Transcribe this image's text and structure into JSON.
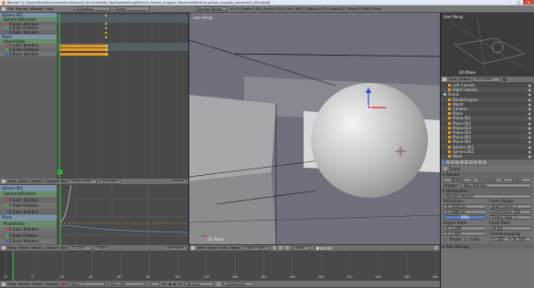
{
  "window": {
    "title": "Blender* [C:\\Users\\Tom\\Documents\\Architecture\\2 Alt Architektur Nachbearbeitung\\Particle_Sphere_Irregular_Movement\\Particle_sphere_Irregular_movement_003.blend]",
    "minimize": "–",
    "maximize": "□",
    "close": "✕"
  },
  "info_header": {
    "menus": [
      "File",
      "Render",
      "Window",
      "Help"
    ],
    "layout": "Animation",
    "scene": "Scene",
    "engine": "Blender Render",
    "stats": "v2.71 | Verts:7,478 | Faces:7,314 | Tris:7,660 | Objects:1/13 | Lamps:0/1 | Mem:13.19M | Plane"
  },
  "dopesheet_top": {
    "channels": [
      {
        "label": "Sphere.001",
        "kind": "object"
      },
      {
        "label": "Sphere.001Action",
        "kind": "action"
      },
      {
        "label": "X Euler Rotation",
        "kind": "fcurve",
        "color": "#d04040"
      },
      {
        "label": "Y Euler Rotation",
        "kind": "fcurve",
        "color": "#40b040"
      },
      {
        "label": "Z Euler Rotation",
        "kind": "fcurve",
        "color": "#4060d0"
      },
      {
        "label": "Plane",
        "kind": "object"
      },
      {
        "label": "PlaneAction",
        "kind": "action"
      },
      {
        "label": "X Euler Rotation",
        "kind": "fcurve",
        "color": "#d04040"
      },
      {
        "label": "Y Euler Rotation",
        "kind": "fcurve",
        "color": "#40b040"
      },
      {
        "label": "Z Euler Rotation",
        "kind": "fcurve",
        "color": "#4060d0"
      }
    ],
    "frame_label": "0"
  },
  "dopesheet_header": {
    "menus": [
      "View",
      "Select",
      "Marker",
      "Channel",
      "Key"
    ],
    "mode": "Dope Sheet",
    "summary": "Summary",
    "filters": "Filters"
  },
  "graph_editor": {
    "channels": [
      {
        "label": "Sphere.001",
        "kind": "object"
      },
      {
        "label": "Sphere.001Action",
        "kind": "action"
      },
      {
        "label": "X Euler Rotation",
        "kind": "fcurve",
        "color": "#d04040"
      },
      {
        "label": "Y Euler Rotation",
        "kind": "fcurve",
        "color": "#40b040"
      },
      {
        "label": "Z Euler Rotation",
        "kind": "fcurve",
        "color": "#4060d0"
      },
      {
        "label": "Plane",
        "kind": "object"
      },
      {
        "label": "PlaneAction",
        "kind": "action"
      },
      {
        "label": "X Euler Rotation",
        "kind": "fcurve",
        "color": "#d04040"
      },
      {
        "label": "Y Euler Rotation",
        "kind": "fcurve",
        "color": "#40b040"
      },
      {
        "label": "Z Euler Rotation",
        "kind": "fcurve",
        "color": "#4060d0"
      }
    ],
    "header_menus": [
      "View",
      "Select",
      "Marker",
      "Channel",
      "Key"
    ],
    "mode": "F-Curve",
    "filters": "Filters",
    "normalize": "Normalize"
  },
  "viewport": {
    "label_top": "User Persp",
    "label_bottom": "(0) Plane",
    "header_menus": [
      "View",
      "Select",
      "Add",
      "Object"
    ],
    "mode": "Object Mode",
    "pivot": "Global"
  },
  "timeline": {
    "ticks": [
      "-20",
      "0",
      "20",
      "40",
      "60",
      "80",
      "100",
      "120",
      "140",
      "160",
      "180",
      "200",
      "220",
      "240",
      "260",
      "280"
    ],
    "header_menus": [
      "View",
      "Marker",
      "Frame",
      "Playback"
    ],
    "start_label": "Start:",
    "start_value": "1",
    "end_label": "End:",
    "end_value": "250",
    "current_frame": "0",
    "sync": "No Sync",
    "keying": "LocRotScale"
  },
  "camera_preview": {
    "label_top": "User Persp",
    "label_bottom": "(0) Plane"
  },
  "outliner": {
    "header_menus": [
      "View",
      "Search"
    ],
    "filter": "All Scenes",
    "items": [
      {
        "label": "Left Camera",
        "indent": 1
      },
      {
        "label": "Right Camera",
        "indent": 1
      },
      {
        "label": "Scene",
        "indent": 0
      },
      {
        "label": "RenderLayers",
        "indent": 1
      },
      {
        "label": "World",
        "indent": 1
      },
      {
        "label": "Camera",
        "indent": 1
      },
      {
        "label": "Plane",
        "indent": 1
      },
      {
        "label": "Plane.001",
        "indent": 1
      },
      {
        "label": "Plane.002",
        "indent": 1
      },
      {
        "label": "Plane.003",
        "indent": 1
      },
      {
        "label": "Plane.004",
        "indent": 1
      },
      {
        "label": "Plane.005",
        "indent": 1
      },
      {
        "label": "Plane.006",
        "indent": 1
      },
      {
        "label": "Sphere.001",
        "indent": 1
      },
      {
        "label": "Sphere.002",
        "indent": 1
      },
      {
        "label": "Wind",
        "indent": 1
      }
    ]
  },
  "properties": {
    "breadcrumb": "Scene",
    "sections": {
      "render": "Render",
      "dimensions": "Dimensions",
      "anti_aliasing": "Anti-Aliasing"
    },
    "tabs": [
      "Render",
      "Animation",
      "Audio"
    ],
    "display_label": "Display:",
    "display_value": "New Window",
    "presets": "Render Presets",
    "resolution_label": "Resolution:",
    "res_x": "X: 1920 px",
    "res_y": "Y: 1080 px",
    "res_pct": "50%",
    "aspect_label": "Aspect Ratio:",
    "aspect_x": "X: 1.000",
    "aspect_y": "Y: 1.000",
    "border": "Border",
    "crop": "Crop",
    "frame_range_label": "Frame Range:",
    "start_frame": "Start Frame: 1",
    "end_frame": "End Frame: 250",
    "frame_step": "Frame Step: 1",
    "frame_rate_label": "Frame Rate:",
    "frame_rate": "24 fps",
    "time_remap_label": "Time Remapping:",
    "remap_old": "O: 100",
    "remap_new": "N: 100"
  },
  "colors": {
    "accent_orange": "#e8961e",
    "selection_blue": "#5680c2",
    "keyframe_green": "#2fd42f",
    "bg_panel": "#727272",
    "bg_dark": "#3f3f3f"
  }
}
